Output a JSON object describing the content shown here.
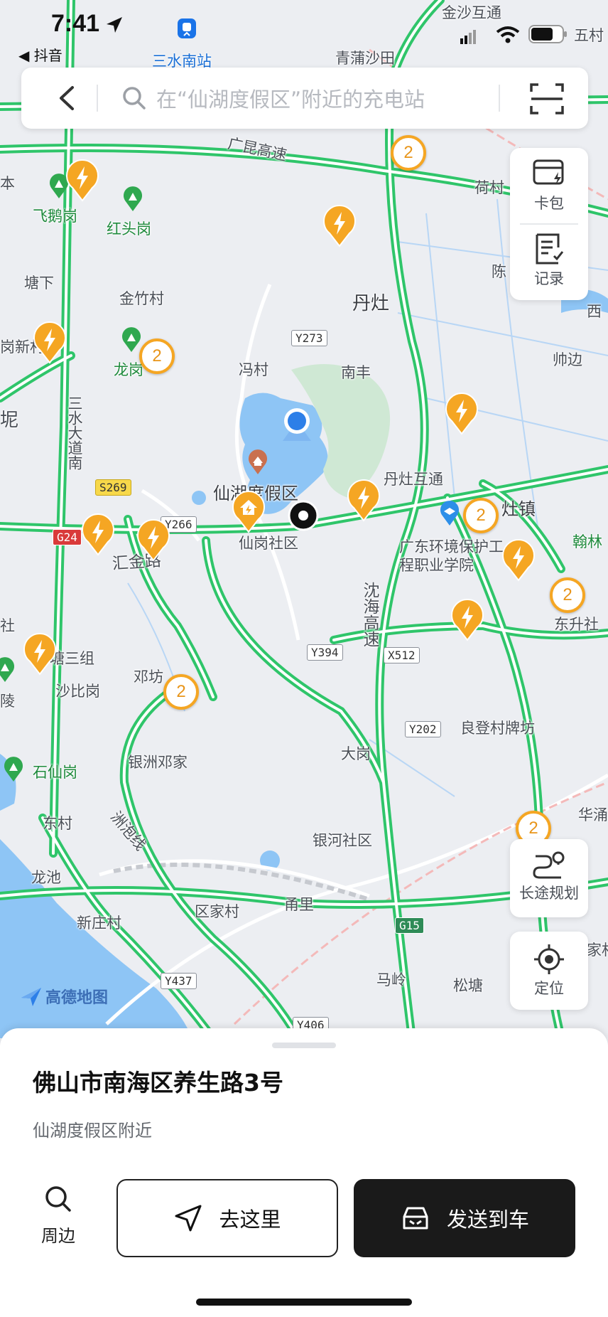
{
  "status_bar": {
    "time": "7:41",
    "back_app": "◀ 抖音"
  },
  "search": {
    "placeholder": "在“仙湖度假区”附近的充电站"
  },
  "side_panel": {
    "card_label": "卡包",
    "record_label": "记录"
  },
  "map_controls": {
    "route_label": "长途规划",
    "locate_label": "定位"
  },
  "map_labels": {
    "sanshui_station": "三水南站",
    "jinsha": "金沙互通",
    "qingpu": "青蒲沙田",
    "wucun": "五村",
    "guangkun": "广昆高速",
    "hecun": "荷村",
    "feiegang": "飞鹅岗",
    "hongtougang": "红头岗",
    "tangxia": "塘下",
    "jinzhucun": "金竹村",
    "dandzao": "丹灶",
    "chen": "陈",
    "xibian": "西",
    "fengcun": "冯村",
    "nanfeng": "南丰",
    "shuaibian": "帅边",
    "longgang": "龙岗",
    "sanshui_road": "三水大道南",
    "nidi": "坭",
    "xinbei": "岗新村",
    "xianhu_resort": "仙湖度假区",
    "dandzao_interchange": "丹灶互通",
    "dandzao_town": "灶镇",
    "hanlin": "翰林",
    "guangdong_college": "广东环境保护工程职业学院",
    "xiangang": "仙岗社区",
    "huijin": "汇金路",
    "dongsheng": "东升社",
    "shenhai": "沈海高速",
    "she": "社",
    "tangsan": "塘三组",
    "shabigang": "沙比岗",
    "dengfang": "邓坊",
    "liangdeng": "良登村牌坊",
    "dagang": "大岗",
    "shixiangang": "石仙岗",
    "yinzhou": "银洲邓家",
    "dongcun": "东村",
    "zhoubaoxian": "洲泡线",
    "yinhe": "银河社区",
    "huapu": "华涌",
    "longchi": "龙池",
    "xinzhuang": "新庄村",
    "oujia": "区家村",
    "yongli": "甬里",
    "majia": "家村",
    "maling": "马岭",
    "songtang": "松塘",
    "ben": "本",
    "ling": "岭",
    "ling2": "陵"
  },
  "road_tags": {
    "y273": "Y273",
    "s269": "S269",
    "y266": "Y266",
    "g24": "G24",
    "y394": "Y394",
    "x512": "X512",
    "y202": "Y202",
    "g15": "G15",
    "y437": "Y437",
    "y406": "Y406"
  },
  "clusters": {
    "c1": "2",
    "c2": "2",
    "c3": "2",
    "c4": "2",
    "c5": "2",
    "c6": "2"
  },
  "logo": {
    "text": "高德地图"
  },
  "place": {
    "address": "佛山市南海区养生路3号",
    "subtitle": "仙湖度假区附近"
  },
  "actions": {
    "nearby_label": "周边",
    "go_label": "去这里",
    "send_label": "发送到车"
  },
  "colors": {
    "road_green": "#2fc56a",
    "charger_orange": "#f5a623",
    "water_blue": "#8ec5f5",
    "button_dark": "#1a1a1a"
  }
}
